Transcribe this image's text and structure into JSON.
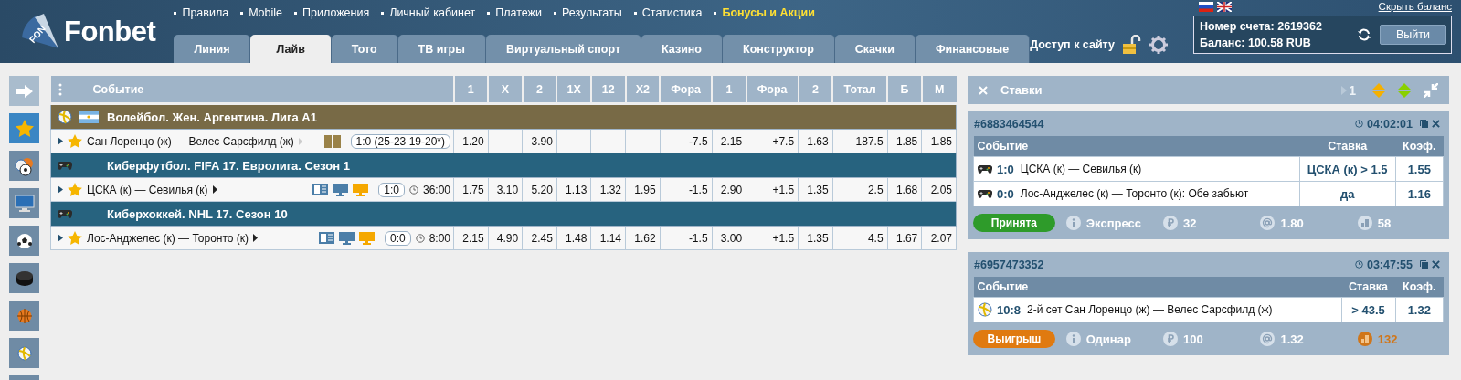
{
  "header": {
    "logo": "Fonbet",
    "logo_mark": "FON",
    "nav": [
      {
        "label": "Правила",
        "highlighted": false
      },
      {
        "label": "Mobile",
        "highlighted": false
      },
      {
        "label": "Приложения",
        "highlighted": false
      },
      {
        "label": "Личный кабинет",
        "highlighted": false
      },
      {
        "label": "Платежи",
        "highlighted": false
      },
      {
        "label": "Результаты",
        "highlighted": false
      },
      {
        "label": "Статистика",
        "highlighted": false
      },
      {
        "label": "Бонусы и Акции",
        "highlighted": true
      }
    ],
    "tabs": [
      {
        "label": "Линия",
        "selected": false
      },
      {
        "label": "Лайв",
        "selected": true
      },
      {
        "label": "Тото",
        "selected": false
      },
      {
        "label": "ТВ игры",
        "selected": false
      },
      {
        "label": "Виртуальный спорт",
        "selected": false
      },
      {
        "label": "Казино",
        "selected": false
      },
      {
        "label": "Конструктор",
        "selected": false
      },
      {
        "label": "Скачки",
        "selected": false
      },
      {
        "label": "Финансовые",
        "selected": false
      }
    ],
    "site_access": "Доступ к сайту",
    "hide_balance": "Скрыть баланс",
    "account": {
      "number": "Номер счета: 2619362",
      "balance": "Баланс: 100.58 RUB",
      "logout": "Выйти"
    }
  },
  "sidebar": {
    "items": [
      {
        "kind": "arrow",
        "selected": false
      },
      {
        "kind": "favorites",
        "selected": true
      },
      {
        "kind": "mixed",
        "selected": false
      },
      {
        "kind": "monitor",
        "selected": false
      },
      {
        "kind": "soccer",
        "selected": false
      },
      {
        "kind": "hockey",
        "selected": false
      },
      {
        "kind": "basketball",
        "selected": false
      },
      {
        "kind": "volleyball",
        "selected": false
      },
      {
        "kind": "other",
        "selected": false
      }
    ]
  },
  "table": {
    "columns": [
      "Событие",
      "1",
      "X",
      "2",
      "1X",
      "12",
      "X2",
      "Фора",
      "1",
      "Фора",
      "2",
      "Тотал",
      "Б",
      "М"
    ],
    "groups": [
      {
        "title": "Волейбол. Жен. Аргентина. Лига А1",
        "kind": "volleyball-argentina",
        "color": "#786a46",
        "events": [
          {
            "name": "Сан Лоренцо (ж) — Велес Сарсфилд (ж)",
            "favorite": true,
            "kind": "stats",
            "score": "1:0 (25-23 19-20*)",
            "odds": [
              {
                "value": "1.20"
              },
              {
                "blank": true
              },
              {
                "value": "3.90"
              },
              {
                "blank": true
              },
              {
                "blank": true
              },
              {
                "blank": true
              },
              {
                "value": "-7.5"
              },
              {
                "value": "2.15"
              },
              {
                "value": "+7.5"
              },
              {
                "value": "1.63"
              },
              {
                "value": "187.5"
              },
              {
                "value": "1.85"
              },
              {
                "value": "1.85"
              }
            ]
          }
        ]
      },
      {
        "title": "Киберфутбол. FIFA 17. Евролига. Сезон 1",
        "kind": "esports",
        "color": "#27637f",
        "events": [
          {
            "name": "ЦСКА (к) — Севилья (к)",
            "favorite": true,
            "kind": "video",
            "score": "1:0",
            "time": "36:00",
            "odds": [
              {
                "value": "1.75"
              },
              {
                "value": "3.10"
              },
              {
                "value": "5.20"
              },
              {
                "value": "1.13"
              },
              {
                "value": "1.32"
              },
              {
                "value": "1.95"
              },
              {
                "value": "-1.5"
              },
              {
                "value": "2.90"
              },
              {
                "value": "+1.5"
              },
              {
                "value": "1.35"
              },
              {
                "value": "2.5"
              },
              {
                "value": "1.68"
              },
              {
                "value": "2.05"
              }
            ]
          }
        ]
      },
      {
        "title": "Киберхоккей. NHL 17. Сезон 10",
        "kind": "esports",
        "color": "#27637f",
        "events": [
          {
            "name": "Лос-Анджелес (к) — Торонто (к)",
            "favorite": true,
            "kind": "video",
            "score": "0:0",
            "time": "8:00",
            "odds": [
              {
                "value": "2.15"
              },
              {
                "value": "4.90"
              },
              {
                "value": "2.45"
              },
              {
                "value": "1.48"
              },
              {
                "value": "1.14"
              },
              {
                "value": "1.62"
              },
              {
                "value": "-1.5"
              },
              {
                "value": "3.00"
              },
              {
                "value": "+1.5"
              },
              {
                "value": "1.35"
              },
              {
                "value": "4.5"
              },
              {
                "value": "1.67"
              },
              {
                "value": "2.07"
              }
            ]
          }
        ]
      }
    ]
  },
  "bets": {
    "title": "Ставки",
    "counter": "1",
    "slips": [
      {
        "id": "#6883464544",
        "time": "04:02:01",
        "columns": [
          "Событие",
          "Ставка",
          "Коэф."
        ],
        "rows": [
          {
            "kind": "esports",
            "score": "1:0",
            "event": "ЦСКА (к) — Севилья (к)",
            "stake": "ЦСКА (к) >  1.5",
            "coef": "1.55"
          },
          {
            "kind": "esports",
            "score": "0:0",
            "event": "Лос-Анджелес (к) — Торонто (к): Обе забьют",
            "stake": "да",
            "coef": "1.16"
          }
        ],
        "color": "#2e9b2a",
        "status_label": "Принята",
        "type": "Экспресс",
        "amount": "32",
        "total_coef": "1.80",
        "payout": "58",
        "payout_highlighted": false
      },
      {
        "id": "#6957473352",
        "time": "03:47:55",
        "columns": [
          "Событие",
          "Ставка",
          "Коэф."
        ],
        "rows": [
          {
            "kind": "volleyball",
            "score": "10:8",
            "event": "2-й сет Сан Лоренцо (ж) — Велес Сарсфилд (ж)",
            "stake": ">  43.5",
            "coef": "1.32"
          }
        ],
        "color": "#e07a10",
        "status_label": "Выигрыш",
        "type": "Одинар",
        "amount": "100",
        "total_coef": "1.32",
        "payout": "132",
        "payout_highlighted": true
      }
    ]
  }
}
